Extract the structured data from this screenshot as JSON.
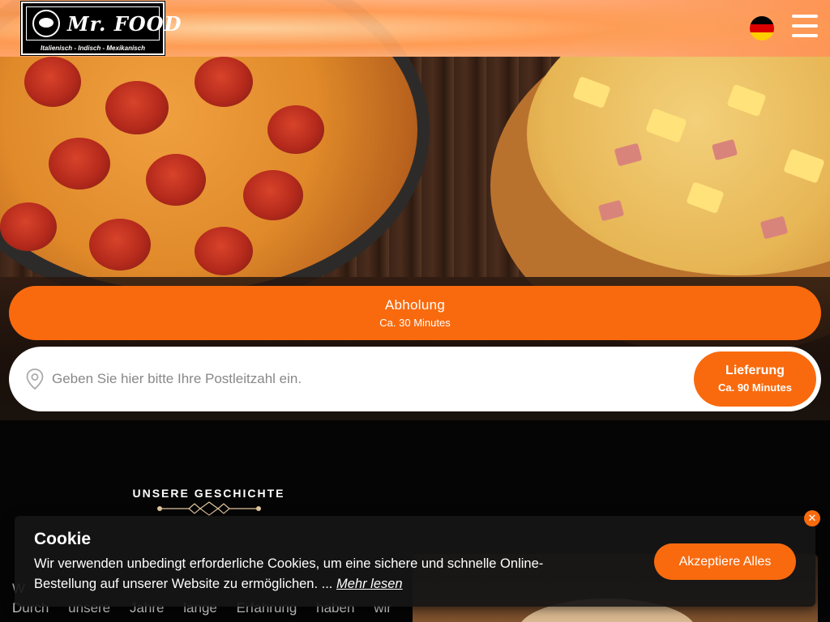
{
  "header": {
    "logo": {
      "title": "Mr. FOOD",
      "subtitle": "Italienisch - Indisch - Mexikanisch"
    },
    "language_flag": "german-flag-icon",
    "menu_icon": "hamburger-menu-icon"
  },
  "order": {
    "pickup_label": "Abholung",
    "pickup_time": "Ca. 30 Minutes",
    "zip_placeholder": "Geben Sie hier bitte Ihre Postleitzahl ein.",
    "zip_value": "",
    "delivery_label": "Lieferung",
    "delivery_time": "Ca. 90 Minutes"
  },
  "story": {
    "heading": "UNSERE  GESCHICHTE",
    "first_char": "W",
    "line_words": [
      "Durch",
      "unsere",
      "Jahre",
      "lange",
      "Erfahrung",
      "haben",
      "wir"
    ]
  },
  "cookie": {
    "title": "Cookie",
    "text": "Wir verwenden unbedingt erforderliche Cookies, um eine sichere und schnelle Online-Bestellung auf unserer Website zu ermöglichen. ...",
    "read_more": "Mehr lesen",
    "accept_label": "Akzeptiere Alles",
    "close_symbol": "✕"
  },
  "colors": {
    "accent": "#f96a0e",
    "background": "#050505"
  }
}
